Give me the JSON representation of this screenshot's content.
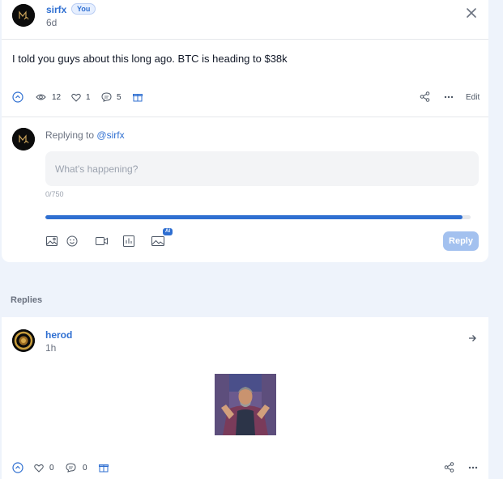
{
  "post": {
    "author": "sirfx",
    "you_badge": "You",
    "time": "6d",
    "text": "I told you guys about this long ago. BTC is heading to $38k",
    "stats": {
      "views": "12",
      "likes": "1",
      "comments": "5"
    },
    "edit_label": "Edit"
  },
  "composer": {
    "replying_prefix": "Replying to",
    "replying_handle": "@sirfx",
    "placeholder": "What's happening?",
    "counter": "0/750",
    "progress_fraction": 0.98,
    "ai_badge": "AI",
    "reply_label": "Reply"
  },
  "replies_section": {
    "title": "Replies"
  },
  "reply": {
    "author": "herod",
    "time": "1h",
    "stats": {
      "likes": "0",
      "comments": "0"
    }
  },
  "icons": {
    "close": "close-icon",
    "upvote": "upvote-icon",
    "views": "eye-icon",
    "like": "heart-icon",
    "comment": "comment-icon",
    "gift": "gift-icon",
    "share": "share-icon",
    "more": "more-icon",
    "image": "image-icon",
    "emoji": "emoji-icon",
    "video": "video-icon",
    "poll": "poll-icon",
    "ai_image": "ai-image-icon",
    "arrow": "arrow-right-icon"
  },
  "colors": {
    "accent": "#2f6fd1",
    "background": "#eef3fb",
    "reply_button": "#a3c1ef"
  }
}
